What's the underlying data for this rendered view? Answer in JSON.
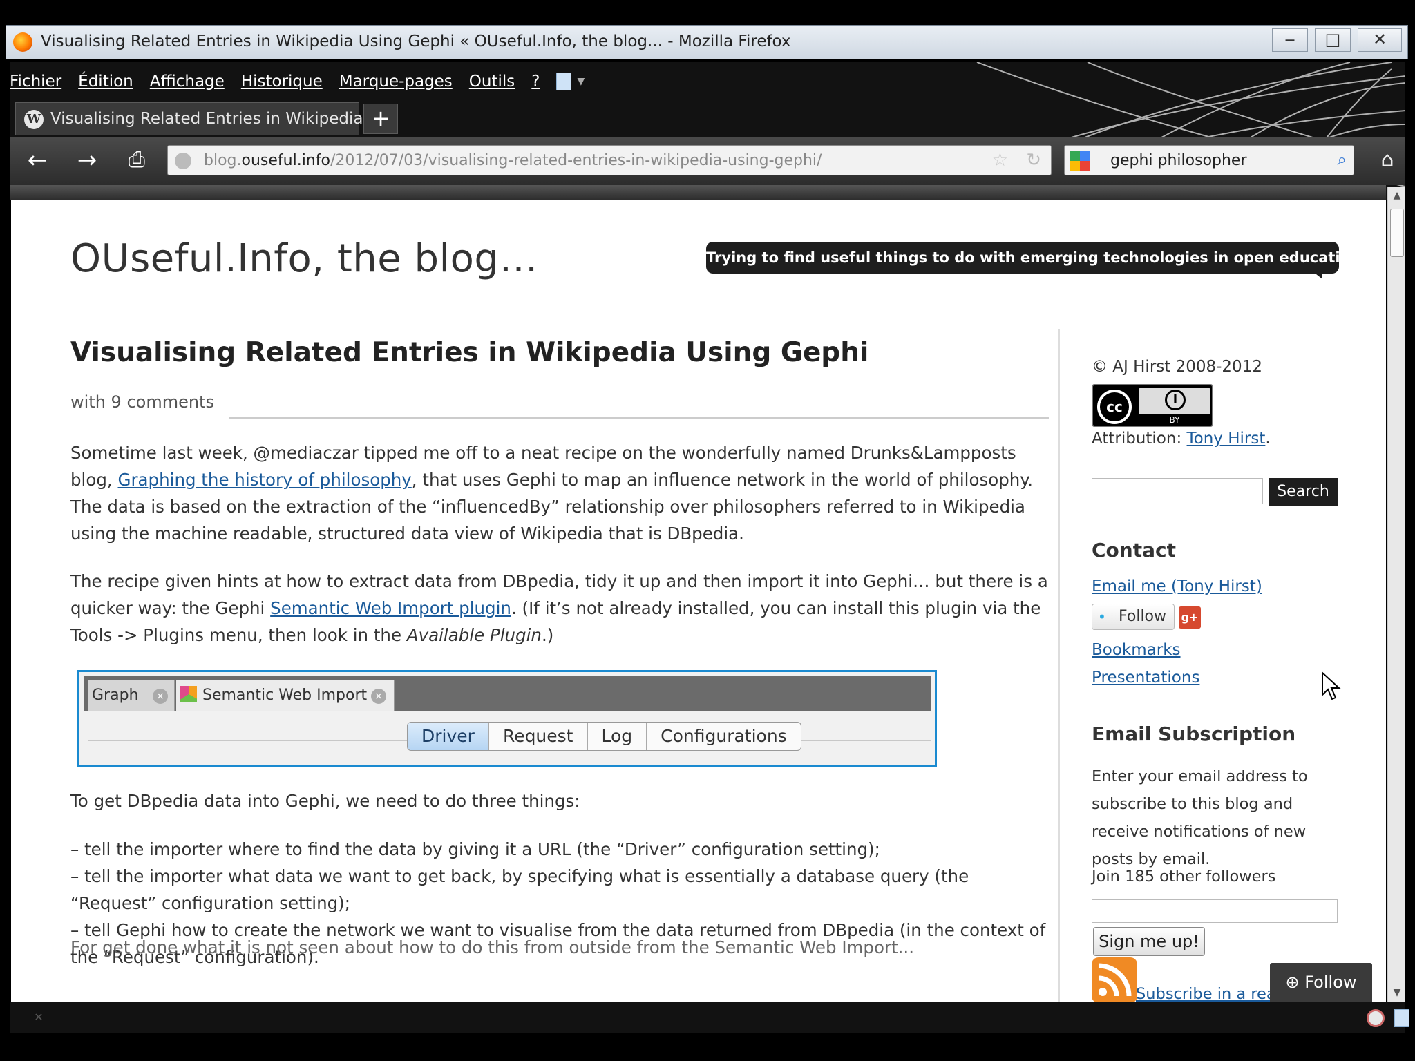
{
  "window": {
    "title": "Visualising Related Entries in Wikipedia Using Gephi « OUseful.Info, the blog... - Mozilla Firefox",
    "min": "‒",
    "max": "□",
    "close": "✕"
  },
  "menu": [
    "Fichier",
    "Édition",
    "Affichage",
    "Historique",
    "Marque-pages",
    "Outils",
    "?"
  ],
  "tab": {
    "title": "Visualising Related Entries in Wikipedia ...",
    "icon": "W",
    "new_tab": "+"
  },
  "nav": {
    "back": "←",
    "forward": "→",
    "print": "⎙",
    "url_prefix": "blog.",
    "url_domain": "ouseful.info",
    "url_path": "/2012/07/03/visualising-related-entries-in-wikipedia-using-gephi/",
    "star": "☆",
    "reload": "↻",
    "search_value": "gephi philosopher",
    "search_icon": "⌕",
    "home": "⌂"
  },
  "blog": {
    "title": "OUseful.Info, the blog…",
    "tagline": "Trying to find useful things to do with emerging technologies in open education"
  },
  "post": {
    "title": "Visualising Related Entries in Wikipedia Using Gephi",
    "comments": "with 9 comments",
    "p1_a": "Sometime last week, @mediaczar tipped me off to a neat recipe on the wonderfully named Drunks&Lampposts blog, ",
    "p1_link": "Graphing the history of philosophy",
    "p1_b": ", that uses Gephi to map an influence network in the world of philosophy. The data is based on the extraction of the “influencedBy” relationship over philosophers referred to in Wikipedia using the machine readable, structured data view of Wikipedia that is DBpedia.",
    "p2_a": "The recipe given hints at how to extract data from DBpedia, tidy it up and then import it into Gephi… but there is a quicker way: the Gephi ",
    "p2_link": "Semantic Web Import plugin",
    "p2_b": ". (If it’s not already installed, you can install this plugin via the Tools -> Plugins menu, then look in the ",
    "p2_em": "Available Plugin",
    "p2_c": ".)",
    "p3": "To get DBpedia data into Gephi, we need to do three things:",
    "p4_1": "– tell the importer where to find the data by giving it a URL (the “Driver” configuration setting);",
    "p4_2": "– tell the importer what data we want to get back, by specifying what is essentially a database query (the “Request” configuration setting);",
    "p4_3": "– tell Gephi how to create the network we want to visualise from the data returned from DBpedia (in the context of the “Request” configuration).",
    "p5": "For get done what it is not seen about how to do this from outside from the Semantic Web Import..."
  },
  "screenshot": {
    "tab_graph": "Graph",
    "tab_sw": "Semantic Web Import",
    "close_glyph": "×",
    "segments": [
      "Driver",
      "Request",
      "Log",
      "Configurations"
    ],
    "active": "Driver"
  },
  "sidebar": {
    "copyright": "© AJ Hirst 2008-2012",
    "cc": "cc",
    "by": "BY",
    "person_glyph": "i",
    "attribution_label": "Attribution: ",
    "attribution_link": "Tony Hirst",
    "attribution_end": ".",
    "search_button": "Search",
    "contact_heading": "Contact",
    "email_link": "Email me (Tony Hirst)",
    "follow_twitter": "Follow",
    "twitter_glyph": "•",
    "gplus": "g+",
    "bookmarks": "Bookmarks",
    "presentations": "Presentations",
    "email_heading": "Email Subscription",
    "email_desc": "Enter your email address to subscribe to this blog and receive notifications of new posts by email.",
    "join": "Join 185 other followers",
    "signup": "Sign me up!",
    "rss_text": "Subscribe in a rea"
  },
  "follow_widget": "⊕ Follow",
  "status": {
    "close": "✕"
  },
  "scroll": {
    "up": "▲",
    "down": "▼"
  }
}
